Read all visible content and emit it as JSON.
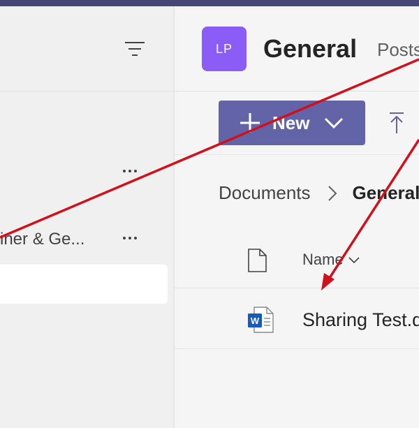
{
  "left_pane": {
    "channel_label": "iner & Ge...",
    "icons": {
      "filter": "filter-lines-icon",
      "more": "more-horizontal-icon"
    }
  },
  "channel": {
    "avatar_initials": "LP",
    "avatar_color": "#8B5CF6",
    "title": "General",
    "tab_posts": "Posts"
  },
  "toolbar": {
    "new_label": "New",
    "accent_color": "#6264A7",
    "icons": {
      "plus": "plus-icon",
      "chevron": "chevron-down-icon",
      "upload": "upload-icon"
    }
  },
  "breadcrumb": {
    "root": "Documents",
    "current": "General"
  },
  "files": {
    "column_name": "Name",
    "rows": [
      {
        "name": "Sharing Test.docx",
        "icon": "word-document-icon"
      }
    ]
  },
  "annotation": {
    "arrow_color": "#D0101B"
  }
}
